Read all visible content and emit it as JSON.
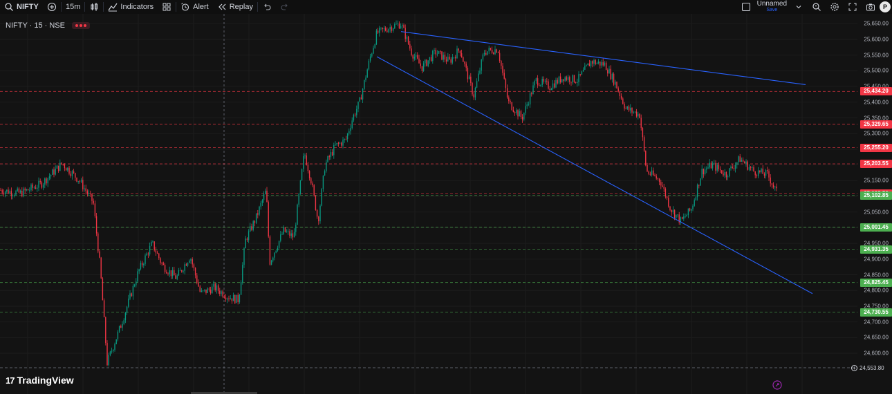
{
  "toolbar": {
    "symbol": "NIFTY",
    "interval": "15m",
    "indicators_label": "Indicators",
    "alert_label": "Alert",
    "replay_label": "Replay",
    "layout_name": "Unnamed",
    "layout_status": "Save",
    "avatar_letter": "P"
  },
  "chart": {
    "legend": "NIFTY · 15 · NSE",
    "logo_text": "TradingView",
    "colors": {
      "up": "#089981",
      "down": "#f23645",
      "trendline": "#2962ff",
      "background": "#131313"
    },
    "price_ticks": [
      "25,650.00",
      "25,600.00",
      "25,550.00",
      "25,500.00",
      "25,450.00",
      "25,400.00",
      "25,350.00",
      "25,300.00",
      "25,250.00",
      "25,200.00",
      "25,150.00",
      "25,100.00",
      "25,050.00",
      "25,000.00",
      "24,950.00",
      "24,900.00",
      "24,850.00",
      "24,800.00",
      "24,750.00",
      "24,700.00",
      "24,650.00",
      "24,600.00"
    ],
    "levels": [
      {
        "label": "25,434.20",
        "value": 25434.2,
        "kind": "resistance"
      },
      {
        "label": "25,329.65",
        "value": 25329.65,
        "kind": "resistance"
      },
      {
        "label": "25,255.20",
        "value": 25255.2,
        "kind": "resistance"
      },
      {
        "label": "25,203.55",
        "value": 25203.55,
        "kind": "resistance"
      },
      {
        "label": "25,109.50",
        "value": 25109.5,
        "kind": "resistance"
      },
      {
        "label": "25,102.85",
        "value": 25102.85,
        "kind": "support"
      },
      {
        "label": "25,001.45",
        "value": 25001.45,
        "kind": "support"
      },
      {
        "label": "24,931.35",
        "value": 24931.35,
        "kind": "support"
      },
      {
        "label": "24,825.45",
        "value": 24825.45,
        "kind": "support"
      },
      {
        "label": "24,730.55",
        "value": 24730.55,
        "kind": "support"
      }
    ],
    "last_label": "24,553.80"
  },
  "chart_data": {
    "type": "line",
    "y_range": [
      24530,
      25675
    ],
    "grid": true,
    "price_path": [
      [
        0,
        25120
      ],
      [
        30,
        25110
      ],
      [
        60,
        25140
      ],
      [
        90,
        25205
      ],
      [
        115,
        25150
      ],
      [
        135,
        25080
      ],
      [
        145,
        24870
      ],
      [
        155,
        24570
      ],
      [
        175,
        24690
      ],
      [
        200,
        24860
      ],
      [
        220,
        24950
      ],
      [
        235,
        24880
      ],
      [
        255,
        24840
      ],
      [
        275,
        24910
      ],
      [
        290,
        24790
      ],
      [
        310,
        24810
      ],
      [
        330,
        24780
      ],
      [
        345,
        24770
      ],
      [
        355,
        24960
      ],
      [
        370,
        25030
      ],
      [
        385,
        25120
      ],
      [
        390,
        24890
      ],
      [
        410,
        24990
      ],
      [
        425,
        24970
      ],
      [
        440,
        25240
      ],
      [
        450,
        25150
      ],
      [
        460,
        25020
      ],
      [
        470,
        25200
      ],
      [
        485,
        25260
      ],
      [
        500,
        25280
      ],
      [
        510,
        25350
      ],
      [
        520,
        25400
      ],
      [
        535,
        25540
      ],
      [
        545,
        25620
      ],
      [
        565,
        25640
      ],
      [
        580,
        25650
      ],
      [
        595,
        25560
      ],
      [
        610,
        25510
      ],
      [
        630,
        25560
      ],
      [
        650,
        25530
      ],
      [
        665,
        25570
      ],
      [
        685,
        25420
      ],
      [
        700,
        25560
      ],
      [
        720,
        25570
      ],
      [
        735,
        25400
      ],
      [
        755,
        25350
      ],
      [
        775,
        25470
      ],
      [
        795,
        25450
      ],
      [
        815,
        25480
      ],
      [
        835,
        25470
      ],
      [
        855,
        25530
      ],
      [
        875,
        25520
      ],
      [
        890,
        25460
      ],
      [
        905,
        25380
      ],
      [
        925,
        25360
      ],
      [
        935,
        25180
      ],
      [
        955,
        25150
      ],
      [
        970,
        25060
      ],
      [
        985,
        25020
      ],
      [
        1000,
        25060
      ],
      [
        1015,
        25180
      ],
      [
        1030,
        25200
      ],
      [
        1050,
        25170
      ],
      [
        1070,
        25220
      ],
      [
        1090,
        25180
      ],
      [
        1110,
        25170
      ],
      [
        1125,
        25105
      ]
    ],
    "trendlines": [
      {
        "from": [
          580,
          25625
        ],
        "to": [
          1165,
          25456
        ]
      },
      {
        "from": [
          545,
          25545
        ],
        "to": [
          1175,
          24790
        ]
      }
    ]
  }
}
